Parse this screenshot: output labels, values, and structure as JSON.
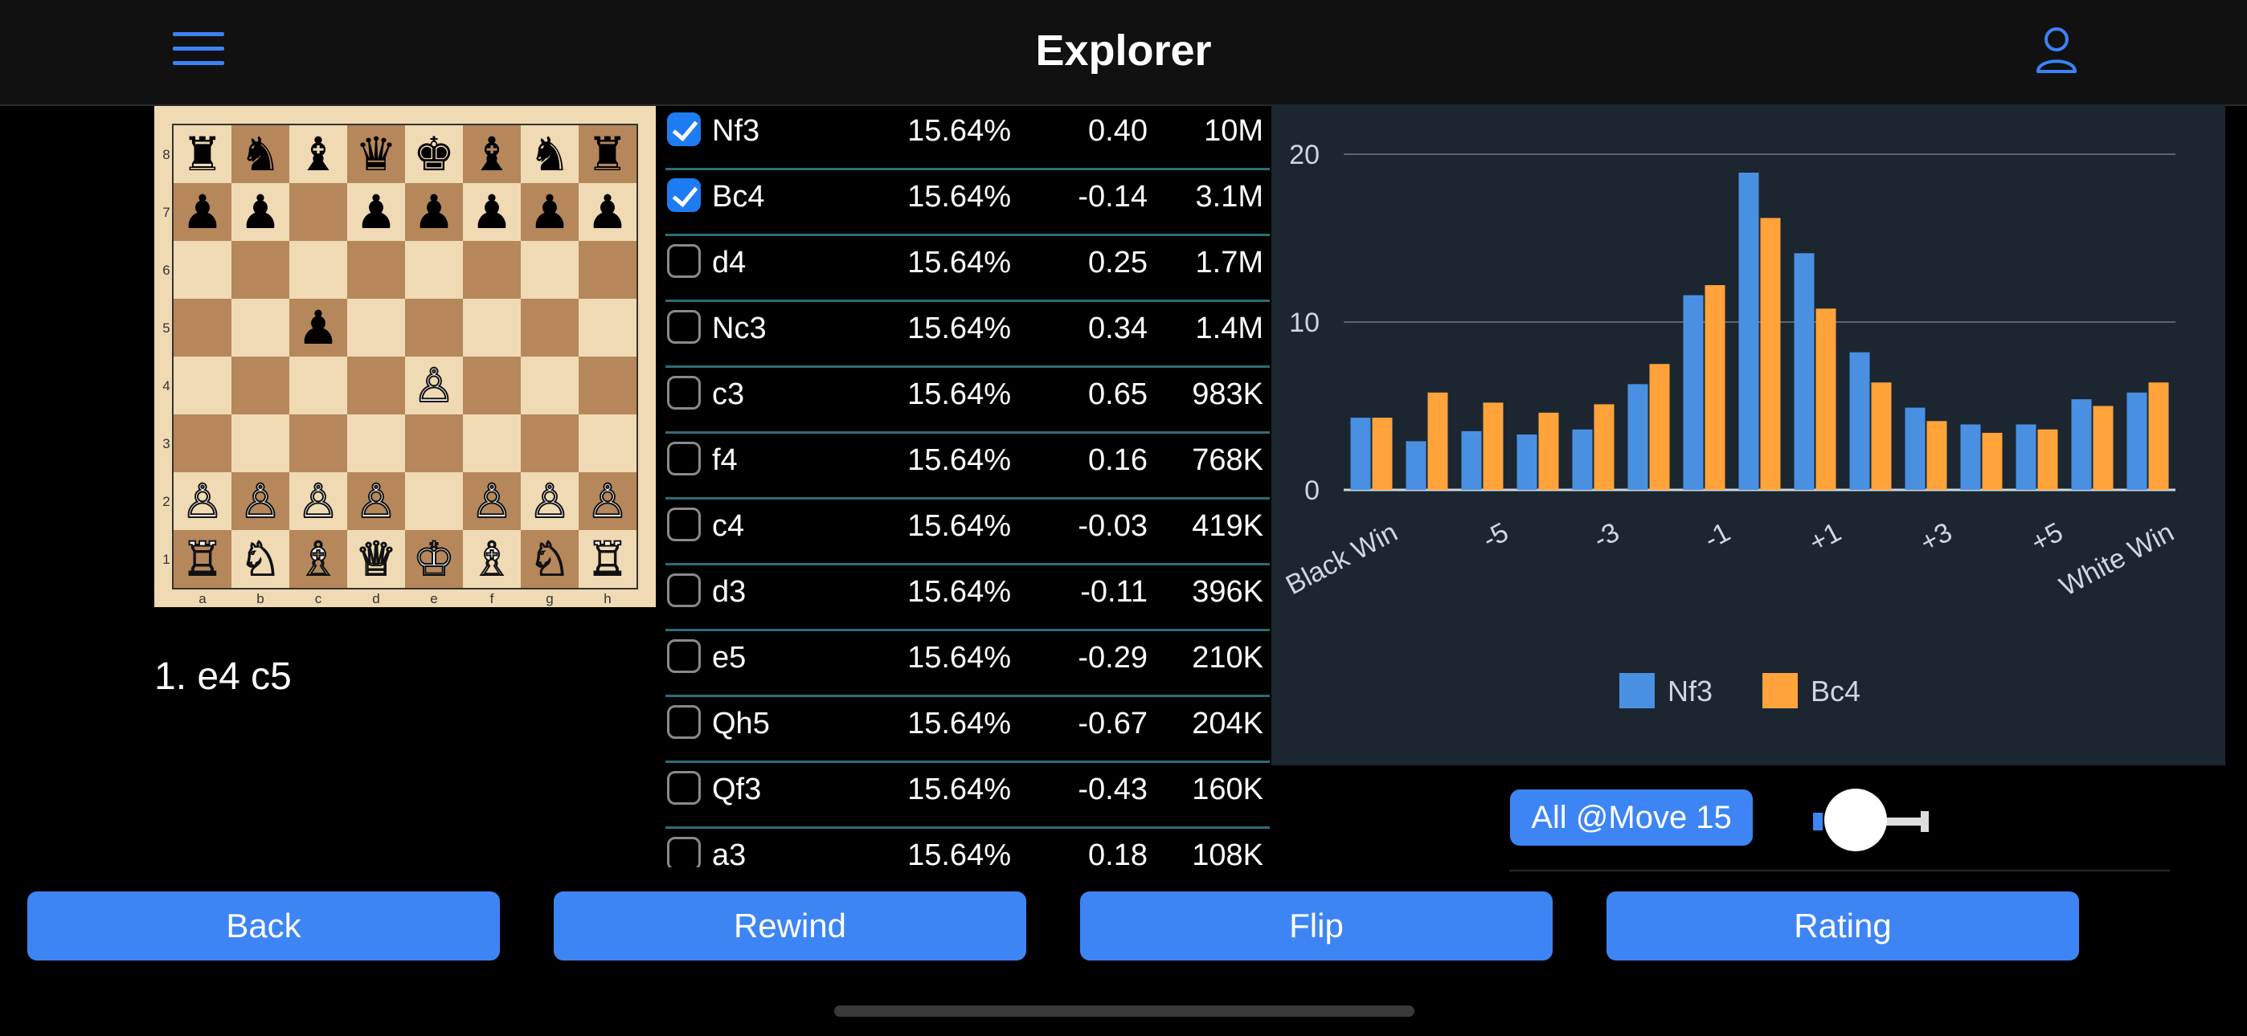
{
  "header": {
    "title": "Explorer",
    "menu_icon": "hamburger-menu-icon",
    "profile_icon": "user-profile-icon"
  },
  "board": {
    "rows": [
      [
        {
          "p": "♜",
          "c": "b"
        },
        {
          "p": "♞",
          "c": "b"
        },
        {
          "p": "♝",
          "c": "b"
        },
        {
          "p": "♛",
          "c": "b"
        },
        {
          "p": "♚",
          "c": "b"
        },
        {
          "p": "♝",
          "c": "b"
        },
        {
          "p": "♞",
          "c": "b"
        },
        {
          "p": "♜",
          "c": "b"
        }
      ],
      [
        {
          "p": "♟",
          "c": "b"
        },
        {
          "p": "♟",
          "c": "b"
        },
        {
          "p": "",
          "c": ""
        },
        {
          "p": "♟",
          "c": "b"
        },
        {
          "p": "♟",
          "c": "b"
        },
        {
          "p": "♟",
          "c": "b"
        },
        {
          "p": "♟",
          "c": "b"
        },
        {
          "p": "♟",
          "c": "b"
        }
      ],
      [
        {
          "p": "",
          "c": ""
        },
        {
          "p": "",
          "c": ""
        },
        {
          "p": "",
          "c": ""
        },
        {
          "p": "",
          "c": ""
        },
        {
          "p": "",
          "c": ""
        },
        {
          "p": "",
          "c": ""
        },
        {
          "p": "",
          "c": ""
        },
        {
          "p": "",
          "c": ""
        }
      ],
      [
        {
          "p": "",
          "c": ""
        },
        {
          "p": "",
          "c": ""
        },
        {
          "p": "♟",
          "c": "b"
        },
        {
          "p": "",
          "c": ""
        },
        {
          "p": "",
          "c": ""
        },
        {
          "p": "",
          "c": ""
        },
        {
          "p": "",
          "c": ""
        },
        {
          "p": "",
          "c": ""
        }
      ],
      [
        {
          "p": "",
          "c": ""
        },
        {
          "p": "",
          "c": ""
        },
        {
          "p": "",
          "c": ""
        },
        {
          "p": "",
          "c": ""
        },
        {
          "p": "♙",
          "c": "w"
        },
        {
          "p": "",
          "c": ""
        },
        {
          "p": "",
          "c": ""
        },
        {
          "p": "",
          "c": ""
        }
      ],
      [
        {
          "p": "",
          "c": ""
        },
        {
          "p": "",
          "c": ""
        },
        {
          "p": "",
          "c": ""
        },
        {
          "p": "",
          "c": ""
        },
        {
          "p": "",
          "c": ""
        },
        {
          "p": "",
          "c": ""
        },
        {
          "p": "",
          "c": ""
        },
        {
          "p": "",
          "c": ""
        }
      ],
      [
        {
          "p": "♙",
          "c": "w"
        },
        {
          "p": "♙",
          "c": "w"
        },
        {
          "p": "♙",
          "c": "w"
        },
        {
          "p": "♙",
          "c": "w"
        },
        {
          "p": "",
          "c": ""
        },
        {
          "p": "♙",
          "c": "w"
        },
        {
          "p": "♙",
          "c": "w"
        },
        {
          "p": "♙",
          "c": "w"
        }
      ],
      [
        {
          "p": "♖",
          "c": "w"
        },
        {
          "p": "♘",
          "c": "w"
        },
        {
          "p": "♗",
          "c": "w"
        },
        {
          "p": "♕",
          "c": "w"
        },
        {
          "p": "♔",
          "c": "w"
        },
        {
          "p": "♗",
          "c": "w"
        },
        {
          "p": "♘",
          "c": "w"
        },
        {
          "p": "♖",
          "c": "w"
        }
      ]
    ],
    "ranks": [
      "8",
      "7",
      "6",
      "5",
      "4",
      "3",
      "2",
      "1"
    ],
    "files": [
      "a",
      "b",
      "c",
      "d",
      "e",
      "f",
      "g",
      "h"
    ],
    "colors": {
      "light": "#f0dab3",
      "dark": "#b5875a"
    }
  },
  "moves_text": "1. e4 c5",
  "move_list": [
    {
      "move": "Nf3",
      "pct": "15.64%",
      "eval": "0.40",
      "count": "10M",
      "checked": true
    },
    {
      "move": "Bc4",
      "pct": "15.64%",
      "eval": "-0.14",
      "count": "3.1M",
      "checked": true
    },
    {
      "move": "d4",
      "pct": "15.64%",
      "eval": "0.25",
      "count": "1.7M",
      "checked": false
    },
    {
      "move": "Nc3",
      "pct": "15.64%",
      "eval": "0.34",
      "count": "1.4M",
      "checked": false
    },
    {
      "move": "c3",
      "pct": "15.64%",
      "eval": "0.65",
      "count": "983K",
      "checked": false
    },
    {
      "move": "f4",
      "pct": "15.64%",
      "eval": "0.16",
      "count": "768K",
      "checked": false
    },
    {
      "move": "c4",
      "pct": "15.64%",
      "eval": "-0.03",
      "count": "419K",
      "checked": false
    },
    {
      "move": "d3",
      "pct": "15.64%",
      "eval": "-0.11",
      "count": "396K",
      "checked": false
    },
    {
      "move": "e5",
      "pct": "15.64%",
      "eval": "-0.29",
      "count": "210K",
      "checked": false
    },
    {
      "move": "Qh5",
      "pct": "15.64%",
      "eval": "-0.67",
      "count": "204K",
      "checked": false
    },
    {
      "move": "Qf3",
      "pct": "15.64%",
      "eval": "-0.43",
      "count": "160K",
      "checked": false
    },
    {
      "move": "a3",
      "pct": "15.64%",
      "eval": "0.18",
      "count": "108K",
      "checked": false
    }
  ],
  "chart_data": {
    "type": "bar",
    "categories": [
      "Black Win",
      "",
      "-5",
      "",
      "-3",
      "",
      "-1",
      "",
      "+1",
      "",
      "+3",
      "",
      "+5",
      "",
      "White Win"
    ],
    "tick_labels": [
      "Black Win",
      "-5",
      "-3",
      "-1",
      "+1",
      "+3",
      "+5",
      "White Win"
    ],
    "series": [
      {
        "name": "Nf3",
        "color": "#4a90e2",
        "values": [
          4.3,
          2.9,
          3.5,
          3.3,
          3.6,
          6.3,
          11.6,
          18.9,
          14.1,
          8.2,
          4.9,
          3.9,
          3.9,
          5.4,
          5.8
        ]
      },
      {
        "name": "Bc4",
        "color": "#ffa33a",
        "values": [
          4.3,
          5.8,
          5.2,
          4.6,
          5.1,
          7.5,
          12.2,
          16.2,
          10.8,
          6.4,
          4.1,
          3.4,
          3.6,
          5.0,
          6.4
        ]
      }
    ],
    "ylim": [
      0,
      20
    ],
    "yticks": [
      "0",
      "10",
      "20"
    ],
    "grid": true,
    "legend": "bottom-center",
    "background": "#1b2631"
  },
  "controls": {
    "filter_label": "All @Move 15",
    "slider_value": 0.1
  },
  "buttons": {
    "back": "Back",
    "rewind": "Rewind",
    "flip": "Flip",
    "rating": "Rating"
  },
  "accent": "#3d85f5"
}
